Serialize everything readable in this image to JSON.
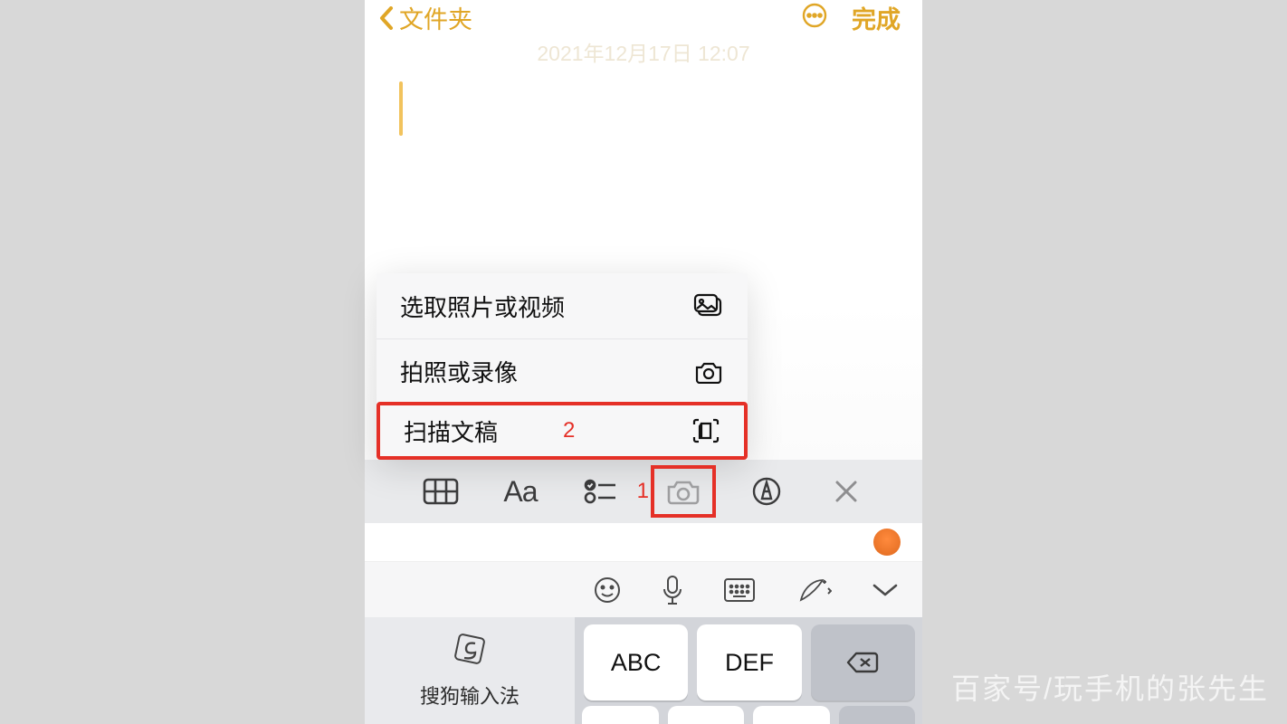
{
  "nav": {
    "back_label": "文件夹",
    "done_label": "完成"
  },
  "note": {
    "timestamp": "2021年12月17日 12:07"
  },
  "context_menu": {
    "items": [
      {
        "label": "选取照片或视频"
      },
      {
        "label": "拍照或录像"
      },
      {
        "label": "扫描文稿"
      }
    ]
  },
  "annotations": {
    "step1": "1",
    "step2": "2"
  },
  "ime": {
    "brand": "搜狗输入法"
  },
  "keys": {
    "abc": "ABC",
    "def": "DEF"
  },
  "watermark": "百家号/玩手机的张先生"
}
